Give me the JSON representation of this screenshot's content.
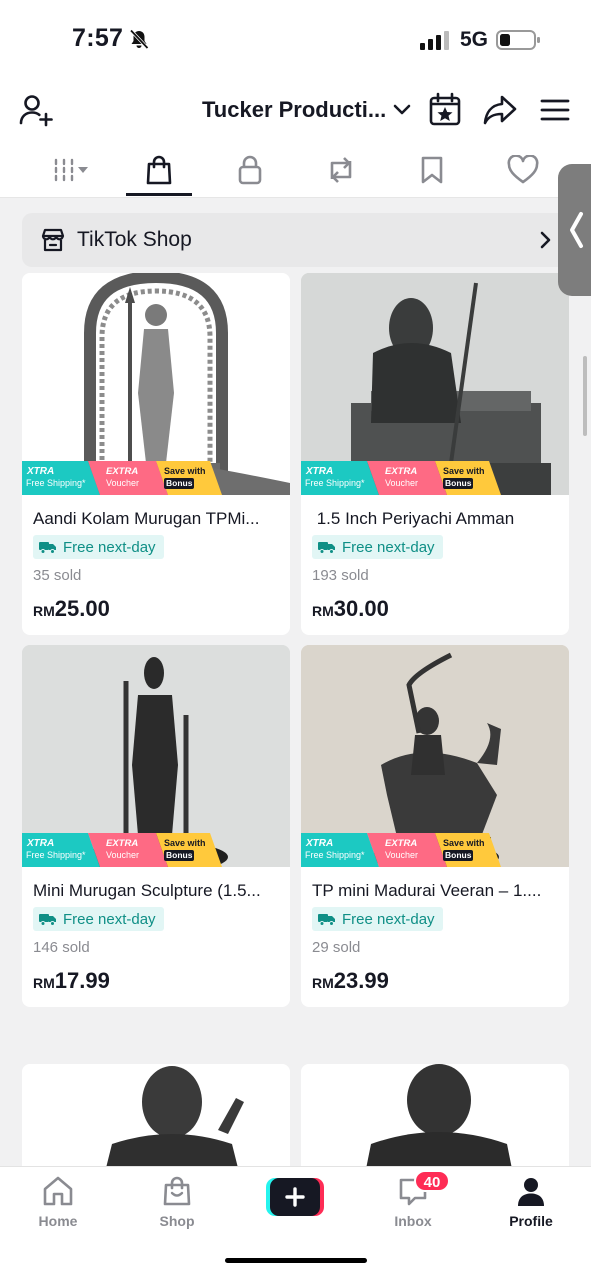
{
  "status_bar": {
    "time": "7:57",
    "network": "5G",
    "icons": [
      "bell-muted-icon",
      "signal-icon",
      "battery-icon"
    ]
  },
  "header": {
    "title": "Tucker Producti...",
    "icons": [
      "add-user-icon",
      "chevron-down-icon",
      "calendar-star-icon",
      "share-icon",
      "menu-icon"
    ]
  },
  "tabs": [
    {
      "name": "videos-grid",
      "icon": "grid-icon"
    },
    {
      "name": "shop",
      "icon": "shopping-bag-icon",
      "active": true
    },
    {
      "name": "private",
      "icon": "lock-icon"
    },
    {
      "name": "reposts",
      "icon": "repost-icon"
    },
    {
      "name": "favorites",
      "icon": "bookmark-icon"
    },
    {
      "name": "liked",
      "icon": "heart-icon"
    }
  ],
  "shop_banner": {
    "label": "TikTok Shop",
    "icon": "store-icon"
  },
  "promo_badges": {
    "xtra_title": "XTRA",
    "xtra_sub": "Free Shipping*",
    "extra_title": "EXTRA",
    "extra_sub": "Voucher",
    "bonus_title": "Save with",
    "bonus_sub": "Bonus"
  },
  "products": [
    {
      "title": "Aandi Kolam Murugan TPMi...",
      "shipping": "Free next-day",
      "sold": "35 sold",
      "currency": "RM",
      "price": "25.00"
    },
    {
      "title": " 1.5 Inch Periyachi Amman",
      "shipping": "Free next-day",
      "sold": "193 sold",
      "currency": "RM",
      "price": "30.00"
    },
    {
      "title": "Mini Murugan Sculpture (1.5...",
      "shipping": "Free next-day",
      "sold": "146 sold",
      "currency": "RM",
      "price": "17.99"
    },
    {
      "title": "TP mini Madurai Veeran – 1....",
      "shipping": "Free next-day",
      "sold": "29 sold",
      "currency": "RM",
      "price": "23.99"
    }
  ],
  "bottom_nav": {
    "home": "Home",
    "shop": "Shop",
    "inbox": "Inbox",
    "inbox_badge": "40",
    "profile": "Profile"
  },
  "colors": {
    "accent_red": "#fe2c55",
    "accent_cyan": "#25f4ee",
    "teal_text": "#0f8f86"
  }
}
